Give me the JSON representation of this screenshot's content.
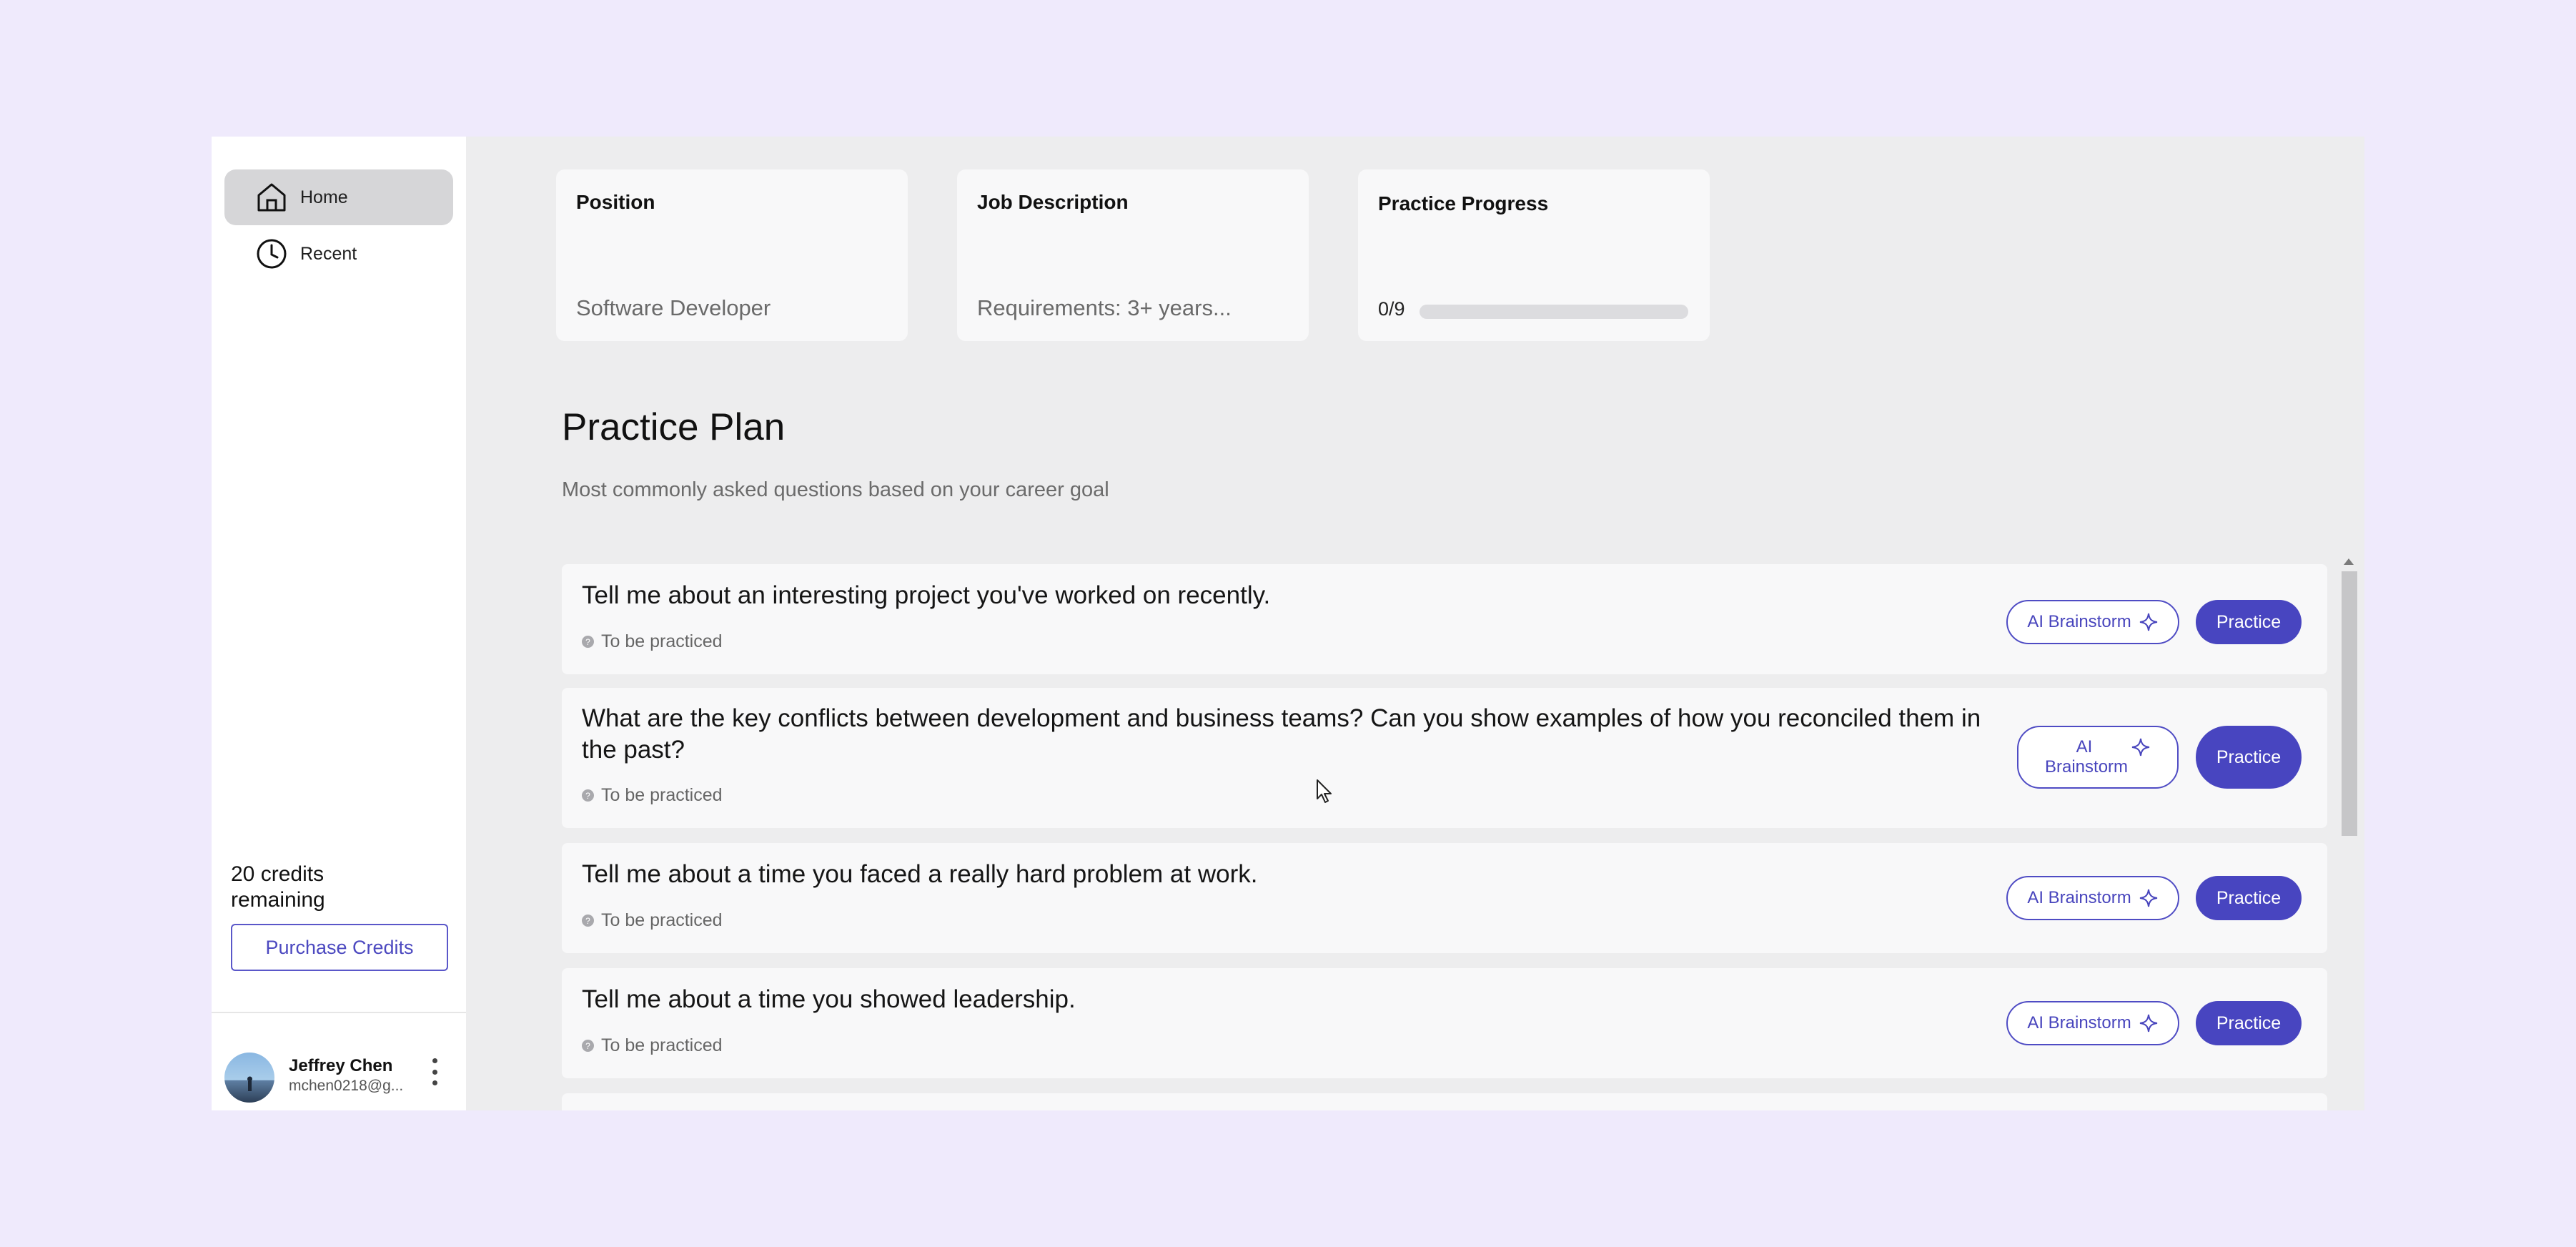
{
  "sidebar": {
    "nav": [
      {
        "label": "Home",
        "icon": "home-icon",
        "active": true
      },
      {
        "label": "Recent",
        "icon": "clock-icon",
        "active": false
      }
    ],
    "credits_text": "20 credits remaining",
    "purchase_label": "Purchase Credits",
    "user": {
      "name": "Jeffrey Chen",
      "email": "mchen0218@g..."
    }
  },
  "cards": {
    "position": {
      "title": "Position",
      "value": "Software Developer"
    },
    "job_description": {
      "title": "Job Description",
      "value": "Requirements: 3+ years..."
    },
    "progress": {
      "title": "Practice Progress",
      "value_text": "0/9",
      "completed": 0,
      "total": 9
    }
  },
  "plan": {
    "title": "Practice Plan",
    "subtitle": "Most commonly asked questions based on your career goal",
    "brainstorm_label": "AI Brainstorm",
    "practice_label": "Practice",
    "questions": [
      {
        "text": "Tell me about an interesting project you've worked on recently.",
        "status": "To be practiced"
      },
      {
        "text": "What are the key conflicts between development and business teams? Can you show examples of how you reconciled them in the past?",
        "status": "To be practiced"
      },
      {
        "text": "Tell me about a time you faced a really hard problem at work.",
        "status": "To be practiced"
      },
      {
        "text": "Tell me about a time you showed leadership.",
        "status": "To be practiced"
      }
    ]
  },
  "colors": {
    "accent": "#4845c0",
    "background": "#efeafc",
    "panel": "#ededee"
  }
}
